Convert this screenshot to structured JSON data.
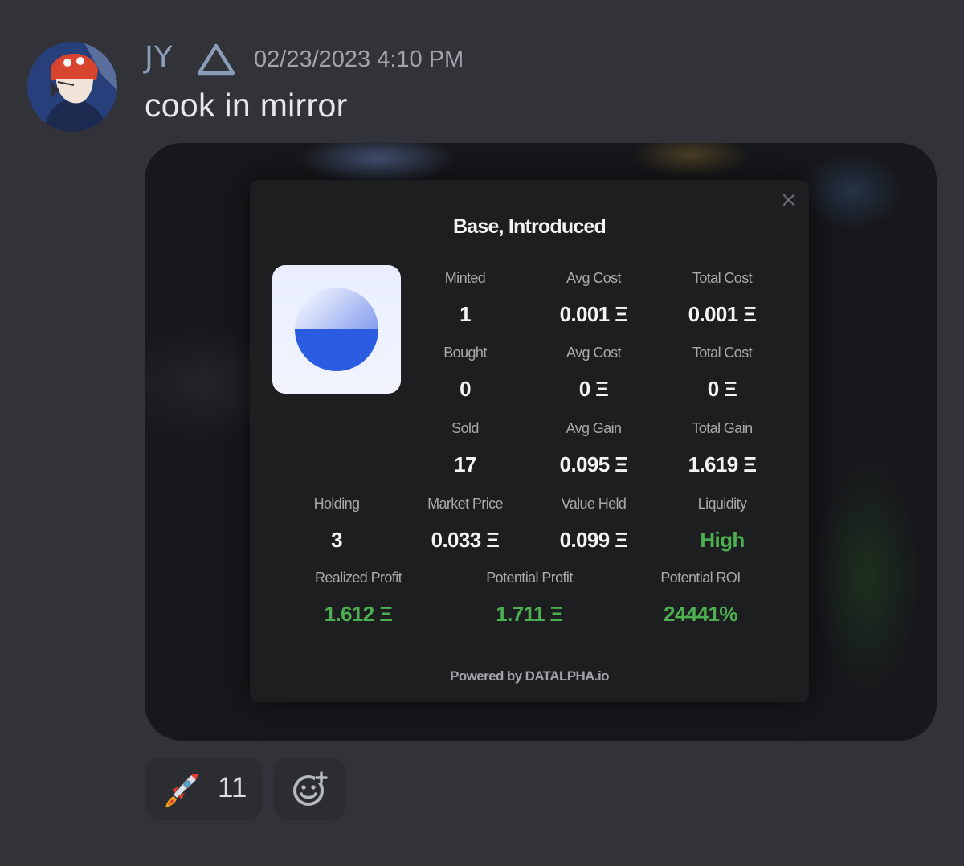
{
  "message": {
    "author": "JY",
    "role_icon": "triangle-icon",
    "timestamp": "02/23/2023 4:10 PM",
    "content": "cook in mirror"
  },
  "embed": {
    "close_glyph": "×",
    "title": "Base, Introduced",
    "logo_icon": "base-logo-icon",
    "stats": [
      {
        "label": "Minted",
        "value": "1"
      },
      {
        "label": "Avg Cost",
        "value": "0.001 Ξ"
      },
      {
        "label": "Total Cost",
        "value": "0.001 Ξ"
      },
      {
        "label": "Bought",
        "value": "0"
      },
      {
        "label": "Avg Cost",
        "value": "0 Ξ"
      },
      {
        "label": "Total Cost",
        "value": "0 Ξ"
      },
      {
        "label": "Sold",
        "value": "17"
      },
      {
        "label": "Avg Gain",
        "value": "0.095 Ξ"
      },
      {
        "label": "Total Gain",
        "value": "1.619 Ξ"
      },
      {
        "label": "Holding",
        "value": "3"
      },
      {
        "label": "Market Price",
        "value": "0.033 Ξ"
      },
      {
        "label": "Value Held",
        "value": "0.099 Ξ"
      },
      {
        "label": "Liquidity",
        "value": "High"
      },
      {
        "label": "Realized Profit",
        "value": "1.612 Ξ"
      },
      {
        "label": "Potential Profit",
        "value": "1.711 Ξ"
      },
      {
        "label": "Potential ROI",
        "value": "24441%"
      }
    ],
    "powered_by": "Powered by DATALPHA.io",
    "highlight_color": "#4caf50"
  },
  "reactions": [
    {
      "emoji": "rocket-icon",
      "count": "11"
    }
  ],
  "add_reaction_icon": "add-reaction-icon"
}
